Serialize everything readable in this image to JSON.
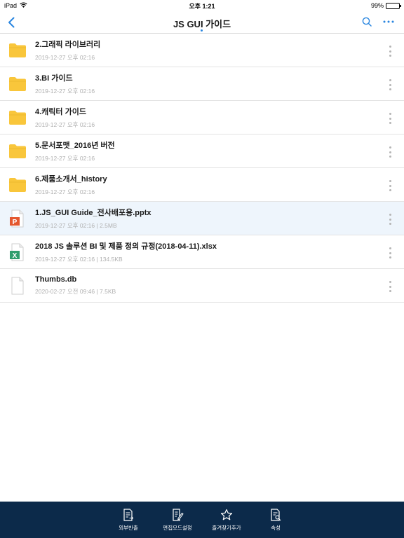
{
  "status_bar": {
    "device": "iPad",
    "time": "오후 1:21",
    "battery": "99%",
    "battery_level": 0.99
  },
  "nav": {
    "title": "JS GUI 가이드"
  },
  "files": [
    {
      "type": "folder",
      "name": "2.그래픽 라이브러리",
      "meta": "2019-12-27 오후 02:16"
    },
    {
      "type": "folder",
      "name": "3.BI 가이드",
      "meta": "2019-12-27 오후 02:16"
    },
    {
      "type": "folder",
      "name": "4.캐릭터 가이드",
      "meta": "2019-12-27 오후 02:16"
    },
    {
      "type": "folder",
      "name": "5.문서포맷_2016년 버전",
      "meta": "2019-12-27 오후 02:16"
    },
    {
      "type": "folder",
      "name": "6.제품소개서_history",
      "meta": "2019-12-27 오후 02:16"
    },
    {
      "type": "pptx",
      "name": "1.JS_GUI Guide_전사배포용.pptx",
      "meta": "2019-12-27 오후 02:16 | 2.5MB",
      "badge": "P",
      "selected": true
    },
    {
      "type": "xlsx",
      "name": "2018 JS 솔루션 BI 및 제품 정의 규정(2018-04-11).xlsx",
      "meta": "2019-12-27 오후 02:16 | 134.5KB",
      "badge": "X"
    },
    {
      "type": "file",
      "name": "Thumbs.db",
      "meta": "2020-02-27 오전 09:46 | 7.5KB"
    }
  ],
  "toolbar": {
    "export": "외부반출",
    "edit_mode": "편집모드설정",
    "add_favorite": "즐겨찾기추가",
    "properties": "속성"
  },
  "colors": {
    "accent": "#2a86e0",
    "folder": "#f9c63b",
    "pptx": "#e4572e",
    "xlsx": "#2f9e6e",
    "toolbar_bg": "#0c2a4a"
  }
}
